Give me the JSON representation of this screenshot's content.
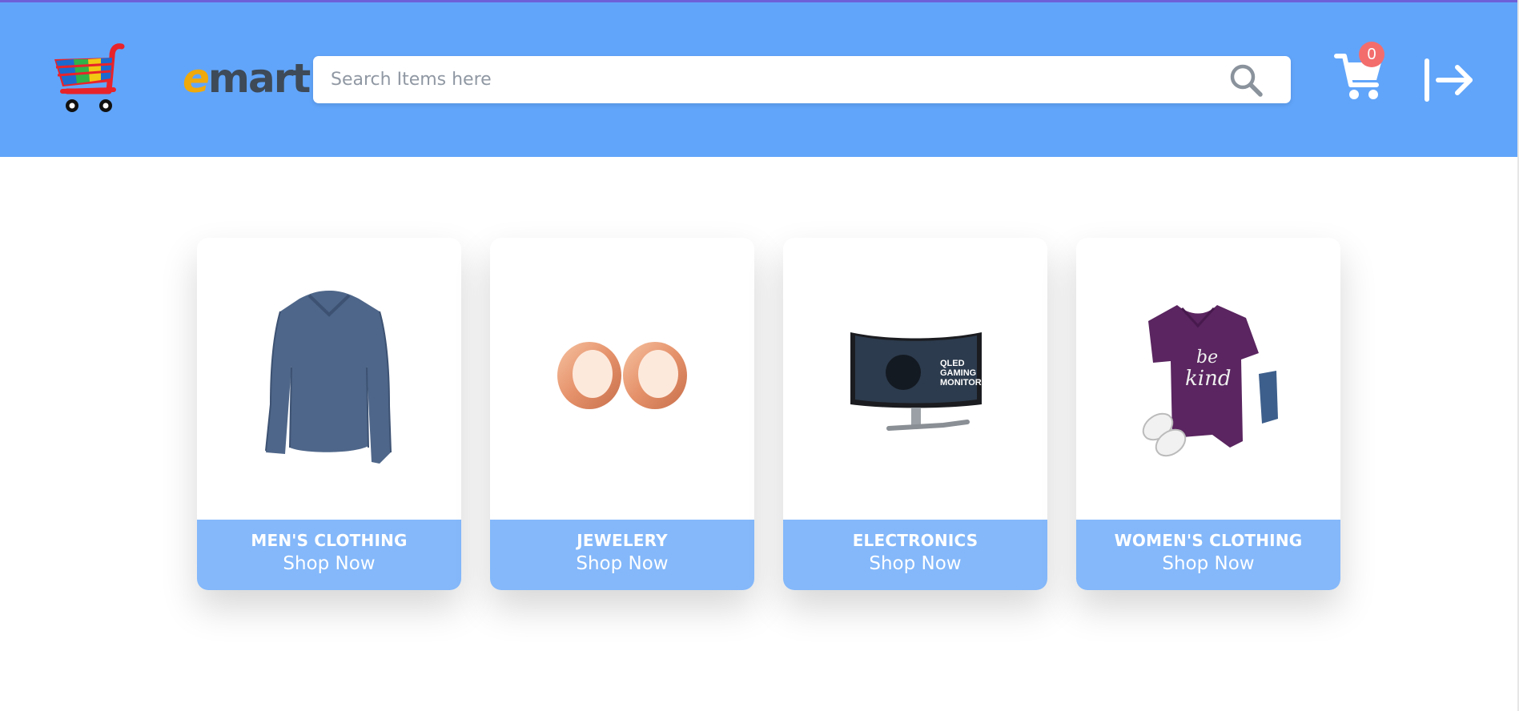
{
  "header": {
    "brand_prefix": "e",
    "brand_suffix": "mart",
    "search_placeholder": "Search Items here",
    "cart_count": "0",
    "background_color": "#61a5fa"
  },
  "icons": {
    "logo": "shopping-cart-logo-icon",
    "search": "search-icon",
    "cart": "cart-icon",
    "logout": "logout-arrow-icon"
  },
  "categories": [
    {
      "name": "MEN'S CLOTHING",
      "cta": "Shop Now"
    },
    {
      "name": "JEWELERY",
      "cta": "Shop Now"
    },
    {
      "name": "ELECTRONICS",
      "cta": "Shop Now"
    },
    {
      "name": "WOMEN'S CLOTHING",
      "cta": "Shop Now"
    }
  ],
  "product_images": {
    "electronics_screen_text": [
      "QLED",
      "GAMING",
      "MONITOR"
    ],
    "womens_shirt_text": [
      "be",
      "kind"
    ]
  },
  "colors": {
    "card_footer": "#84b8fa",
    "badge": "#f36d6d"
  }
}
